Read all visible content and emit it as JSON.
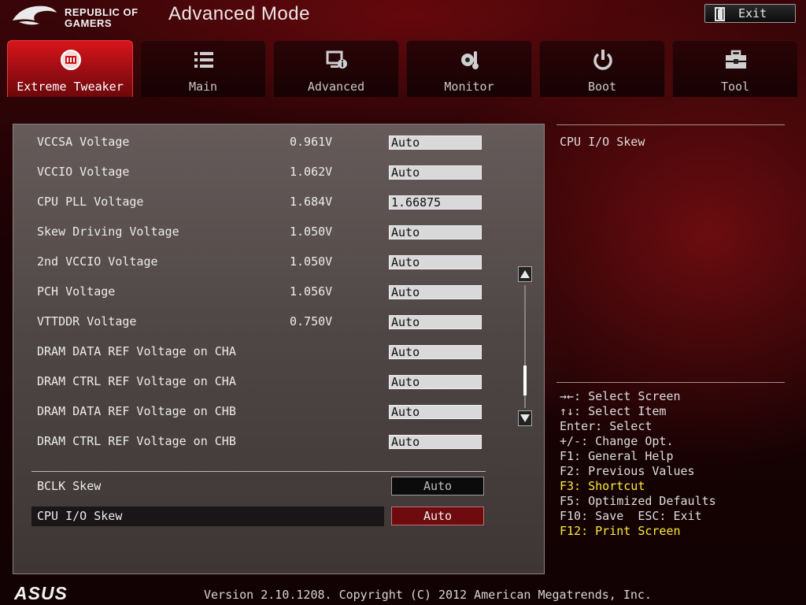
{
  "header": {
    "brand_line1": "REPUBLIC OF",
    "brand_line2": "GAMERS",
    "title": "Advanced Mode",
    "exit_label": "Exit"
  },
  "tabs": [
    {
      "label": "Extreme Tweaker",
      "icon": "tweaker-icon",
      "active": true
    },
    {
      "label": "Main",
      "icon": "list-icon",
      "active": false
    },
    {
      "label": "Advanced",
      "icon": "advanced-icon",
      "active": false
    },
    {
      "label": "Monitor",
      "icon": "monitor-icon",
      "active": false
    },
    {
      "label": "Boot",
      "icon": "power-icon",
      "active": false
    },
    {
      "label": "Tool",
      "icon": "toolbox-icon",
      "active": false
    }
  ],
  "settings": [
    {
      "label": "VCCSA Voltage",
      "value": "0.961V",
      "field": "Auto"
    },
    {
      "label": "VCCIO Voltage",
      "value": "1.062V",
      "field": "Auto"
    },
    {
      "label": "CPU PLL Voltage",
      "value": "1.684V",
      "field": "1.66875"
    },
    {
      "label": "Skew Driving Voltage",
      "value": "1.050V",
      "field": "Auto"
    },
    {
      "label": "2nd VCCIO Voltage",
      "value": "1.050V",
      "field": "Auto"
    },
    {
      "label": "PCH Voltage",
      "value": "1.056V",
      "field": "Auto"
    },
    {
      "label": "VTTDDR Voltage",
      "value": "0.750V",
      "field": "Auto"
    },
    {
      "label": "DRAM DATA REF Voltage on CHA",
      "value": "",
      "field": "Auto"
    },
    {
      "label": "DRAM CTRL REF Voltage on CHA",
      "value": "",
      "field": "Auto"
    },
    {
      "label": "DRAM DATA REF Voltage on CHB",
      "value": "",
      "field": "Auto"
    },
    {
      "label": "DRAM CTRL REF Voltage on CHB",
      "value": "",
      "field": "Auto"
    }
  ],
  "skews": [
    {
      "label": "BCLK Skew",
      "value": "Auto",
      "selected": false
    },
    {
      "label": "CPU I/O Skew",
      "value": "Auto",
      "selected": true
    }
  ],
  "help": {
    "title": "CPU I/O Skew",
    "keys": [
      {
        "text": "→←: Select Screen",
        "highlight": false
      },
      {
        "text": "↑↓: Select Item",
        "highlight": false
      },
      {
        "text": "Enter: Select",
        "highlight": false
      },
      {
        "text": "+/-: Change Opt.",
        "highlight": false
      },
      {
        "text": "F1: General Help",
        "highlight": false
      },
      {
        "text": "F2: Previous Values",
        "highlight": false
      },
      {
        "text": "F3: Shortcut",
        "highlight": true
      },
      {
        "text": "F5: Optimized Defaults",
        "highlight": false
      },
      {
        "text": "F10: Save  ESC: Exit",
        "highlight": false
      },
      {
        "text": "F12: Print Screen",
        "highlight": true
      }
    ]
  },
  "footer": {
    "brand": "ASUS",
    "version": "Version 2.10.1208. Copyright (C) 2012 American Megatrends, Inc."
  },
  "colors": {
    "accent_red": "#d9151b",
    "highlight_yellow": "#ffea3a",
    "selected_button": "#6e0b0f"
  }
}
